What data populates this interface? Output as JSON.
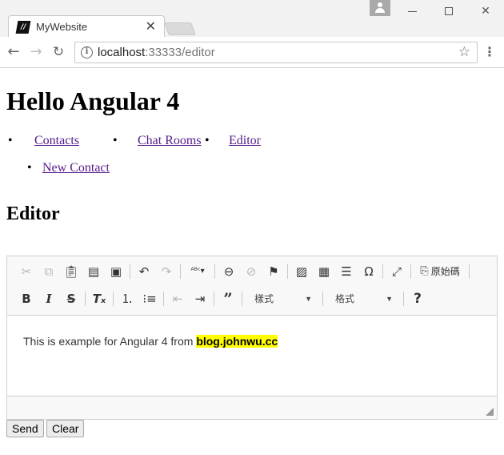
{
  "browser": {
    "tab_title": "MyWebsite",
    "tab_favicon": "//",
    "url_host": "localhost",
    "url_rest": ":33333/editor",
    "icons": {
      "back": "arrow-left-icon",
      "forward": "arrow-right-icon",
      "reload": "reload-icon",
      "info": "info-icon",
      "star": "star-icon",
      "menu": "kebab-menu-icon",
      "close": "close-icon",
      "user": "user-icon"
    }
  },
  "page": {
    "title": "Hello Angular 4",
    "nav": [
      {
        "label": "Contacts"
      },
      {
        "label": "Chat Rooms"
      },
      {
        "label": "Editor"
      },
      {
        "label": "New Contact"
      }
    ],
    "section_heading": "Editor"
  },
  "editor": {
    "toolbar": {
      "source_label": "原始碼",
      "style_combo": "樣式",
      "format_combo": "格式",
      "help_glyph": "?"
    },
    "content": {
      "text": "This is example for Angular 4 from ",
      "highlight": "blog.johnwu.cc",
      "highlight_color": "#ffff00"
    }
  },
  "form": {
    "send_label": "Send",
    "clear_label": "Clear"
  },
  "colors": {
    "link_visited": "#551a8b",
    "toolbar_bg": "#f8f8f8"
  }
}
